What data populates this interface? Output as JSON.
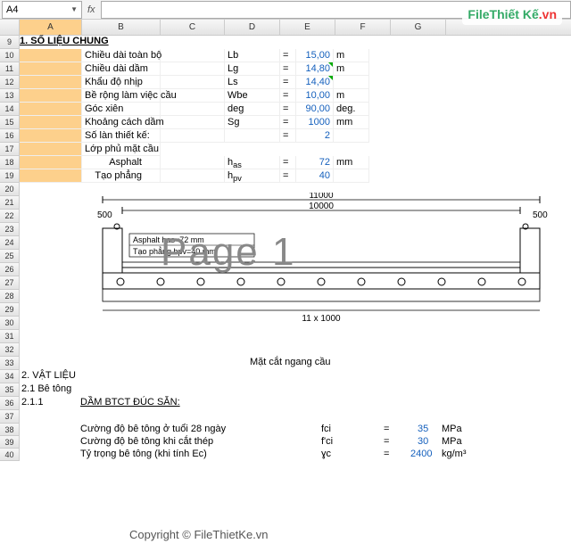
{
  "name_box": "A4",
  "fx_label": "fx",
  "columns": [
    "A",
    "B",
    "C",
    "D",
    "E",
    "F",
    "G"
  ],
  "rows_visible": [
    9,
    10,
    11,
    12,
    13,
    14,
    15,
    16,
    17,
    18,
    19,
    20,
    21,
    22,
    23,
    24,
    25,
    26,
    27,
    28,
    29,
    30,
    31,
    32,
    33,
    34,
    35,
    36,
    37,
    38,
    39,
    40
  ],
  "heading1": "1. SỐ LIỆU CHUNG",
  "params": [
    {
      "label": "Chiều dài toàn bộ",
      "sym": "Lb",
      "eq": "=",
      "val": "15,00",
      "unit": "m",
      "tri": false
    },
    {
      "label": "Chiều dài dầm",
      "sym": "Lg",
      "eq": "=",
      "val": "14,80",
      "unit": "m",
      "tri": true
    },
    {
      "label": "Khẩu độ nhịp",
      "sym": "Ls",
      "eq": "=",
      "val": "14,40",
      "unit": "",
      "tri": true
    },
    {
      "label": "Bề rộng làm việc cầu",
      "sym": "Wbe",
      "eq": "=",
      "val": "10,00",
      "unit": "m",
      "tri": false
    },
    {
      "label": "Góc xiên",
      "sym": "deg",
      "eq": "=",
      "val": "90,00",
      "unit": "deg.",
      "tri": false
    },
    {
      "label": "Khoảng cách dầm",
      "sym": "Sg",
      "eq": "=",
      "val": "1000",
      "unit": "mm",
      "tri": false
    },
    {
      "label": "Số làn thiết kế:",
      "sym": "",
      "eq": "=",
      "val": "2",
      "unit": "",
      "tri": false
    }
  ],
  "overlay": {
    "label": "Lớp phủ mặt cầu"
  },
  "overlay_rows": [
    {
      "label": "Asphalt",
      "sym": "h_as",
      "eq": "=",
      "val": "72",
      "unit": "mm"
    },
    {
      "label": "Tạo phẳng",
      "sym": "h_pv",
      "eq": "=",
      "val": "40",
      "unit": ""
    }
  ],
  "diagram": {
    "top_dim": "11000",
    "inner_dim": "10000",
    "side_dim_l": "500",
    "side_dim_r": "500",
    "note1": "Asphalt has=72 mm",
    "note2": "Tạo phẳng hpv=40 mm",
    "bottom_dim": "11 x 1000",
    "caption": "Mặt cắt ngang cầu"
  },
  "heading2": "2. VẬT LIỆU",
  "heading2_1": "2.1 Bê tông",
  "heading2_1_1": "2.1.1",
  "heading2_1_1_text": "DẦM BTCT ĐÚC SẴN:",
  "mat": [
    {
      "label": "Cường độ bê tông ở tuổi 28 ngày",
      "sym": "fci",
      "eq": "=",
      "val": "35",
      "unit": "MPa"
    },
    {
      "label": "Cường độ bê tông khi cắt thép",
      "sym": "f'ci",
      "eq": "=",
      "val": "30",
      "unit": "MPa"
    },
    {
      "label": "Tỷ trọng bê tông (khi tính Ec)",
      "sym": "ɣc",
      "eq": "=",
      "val": "2400",
      "unit": "kg/m³"
    }
  ],
  "watermark": "Page 1",
  "copyright": "Copyright © FileThietKe.vn",
  "logo": {
    "a": "File",
    "b": "Thiết Kế",
    "c": ".vn"
  }
}
